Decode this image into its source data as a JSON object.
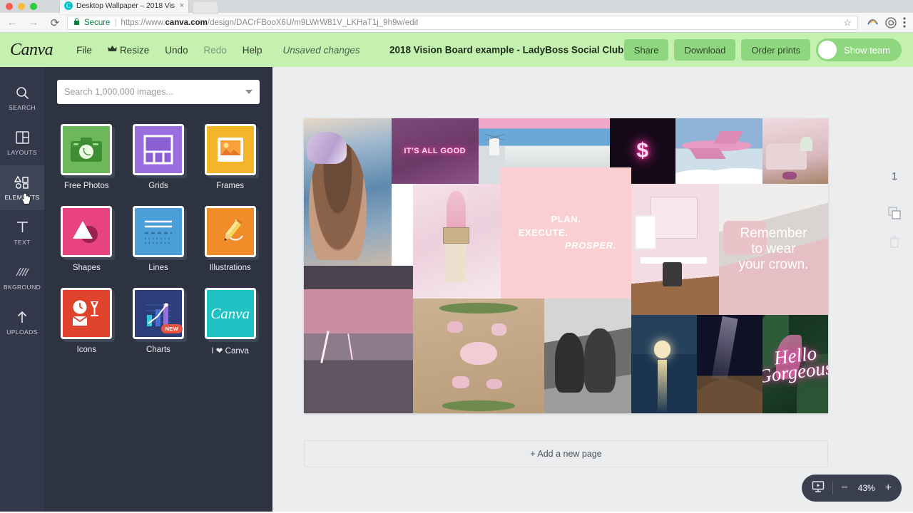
{
  "browser": {
    "tab": {
      "title": "Desktop Wallpaper – 2018 Vis",
      "close": "×",
      "favicon": "canva-favicon"
    },
    "nav": {
      "back": "←",
      "forward": "→",
      "reload": "⟳"
    },
    "url": {
      "lock_icon": "lock-icon",
      "secure_label": "Secure",
      "prefix": "https://www.",
      "domain": "canva.com",
      "path": "/design/DACrFBooX6U/m9LWrW81V_LKHaT1j_9h9w/edit",
      "star_icon": "bookmark-star-icon"
    },
    "icons": [
      "extension-icon",
      "spiral-icon",
      "chrome-menu-icon"
    ]
  },
  "canva": {
    "logo": "Canva",
    "menu": [
      {
        "label": "File",
        "icon": null,
        "dim": false
      },
      {
        "label": "Resize",
        "icon": "crown-icon",
        "dim": false
      },
      {
        "label": "Undo",
        "icon": null,
        "dim": false
      },
      {
        "label": "Redo",
        "icon": null,
        "dim": true
      },
      {
        "label": "Help",
        "icon": null,
        "dim": false
      }
    ],
    "status": "Unsaved changes",
    "doc_title": "2018 Vision Board example - LadyBoss Social Club",
    "actions": [
      "Share",
      "Download",
      "Order prints"
    ],
    "team_button": {
      "label": "Show team",
      "avatar": "user-avatar"
    },
    "header_bg": "#c4f0b0",
    "button_bg": "#8fd77e"
  },
  "rail": {
    "items": [
      {
        "label": "SEARCH",
        "icon": "search-icon",
        "active": false
      },
      {
        "label": "LAYOUTS",
        "icon": "layouts-icon",
        "active": false
      },
      {
        "label": "ELEMENTS",
        "icon": "elements-icon",
        "active": true
      },
      {
        "label": "TEXT",
        "icon": "text-icon",
        "active": false
      },
      {
        "label": "BKGROUND",
        "icon": "background-icon",
        "active": false
      },
      {
        "label": "UPLOADS",
        "icon": "uploads-icon",
        "active": false
      }
    ]
  },
  "panel": {
    "search_placeholder": "Search 1,000,000 images...",
    "search_value": "",
    "dropdown_icon": "chevron-down-icon",
    "tiles": [
      {
        "label": "Free Photos",
        "color": "#6cb85a",
        "icon": "camera-icon",
        "badge": null
      },
      {
        "label": "Grids",
        "color": "#9b6ee0",
        "icon": "grid-icon",
        "badge": null
      },
      {
        "label": "Frames",
        "color": "#f5b battery",
        "icon": "frame-icon",
        "badge": null
      },
      {
        "label": "Shapes",
        "color": "#e8437e",
        "icon": "shapes-icon",
        "badge": null
      },
      {
        "label": "Lines",
        "color": "#4a9fd8",
        "icon": "lines-icon",
        "badge": null
      },
      {
        "label": "Illustrations",
        "color": "#f08d28",
        "icon": "pencil-icon",
        "badge": null
      },
      {
        "label": "Icons",
        "color": "#e0432b",
        "icon": "icons-icon",
        "badge": null
      },
      {
        "label": "Charts",
        "color": "#2b3e7a",
        "icon": "chart-icon",
        "badge": "NEW"
      },
      {
        "label": "I ❤ Canva",
        "color": "#1ec2c2",
        "icon": "canva-script-icon",
        "badge": null
      }
    ]
  },
  "canvas": {
    "add_page_label": "+ Add a new page",
    "page_number": "1",
    "tools": [
      "duplicate-page-icon",
      "delete-page-icon"
    ],
    "zoom": {
      "value": "43%",
      "minus": "−",
      "plus": "+",
      "present_icon": "present-icon"
    },
    "collage": {
      "texts": {
        "its_all_good": "IT'S ALL GOOD",
        "plan": "PLAN.",
        "execute": "EXECUTE.",
        "prosper": "PROSPER.",
        "remember_1": "Remember",
        "remember_2": "to wear",
        "remember_3": "your crown.",
        "hello": "Hello",
        "gorgeous": "Gorgeous"
      }
    }
  }
}
